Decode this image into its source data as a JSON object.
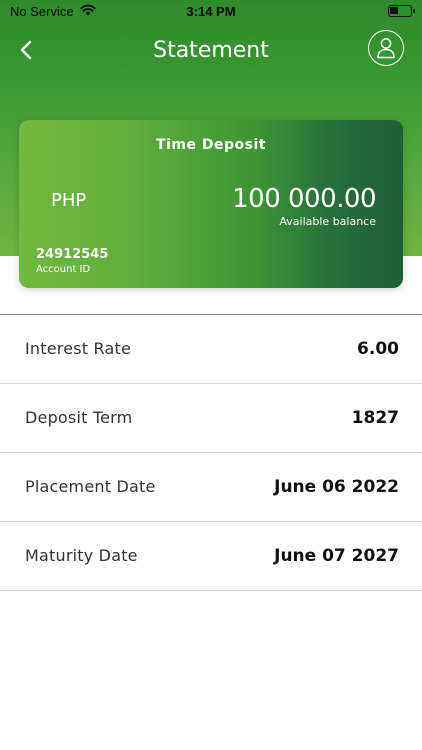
{
  "status_bar": {
    "carrier": "No Service",
    "time": "3:14 PM"
  },
  "nav": {
    "title": "Statement"
  },
  "card": {
    "title": "Time Deposit",
    "currency": "PHP",
    "balance": "100 000.00",
    "balance_label": "Available balance",
    "account_id": "24912545",
    "account_id_label": "Account ID"
  },
  "details": [
    {
      "label": "Interest Rate",
      "value": "6.00"
    },
    {
      "label": "Deposit Term",
      "value": "1827"
    },
    {
      "label": "Placement Date",
      "value": "June 06 2022"
    },
    {
      "label": "Maturity Date",
      "value": "June 07 2027"
    }
  ],
  "colors": {
    "header_green": "#3c9b33",
    "card_light": "#71b83f",
    "card_dark": "#1f5f36"
  }
}
